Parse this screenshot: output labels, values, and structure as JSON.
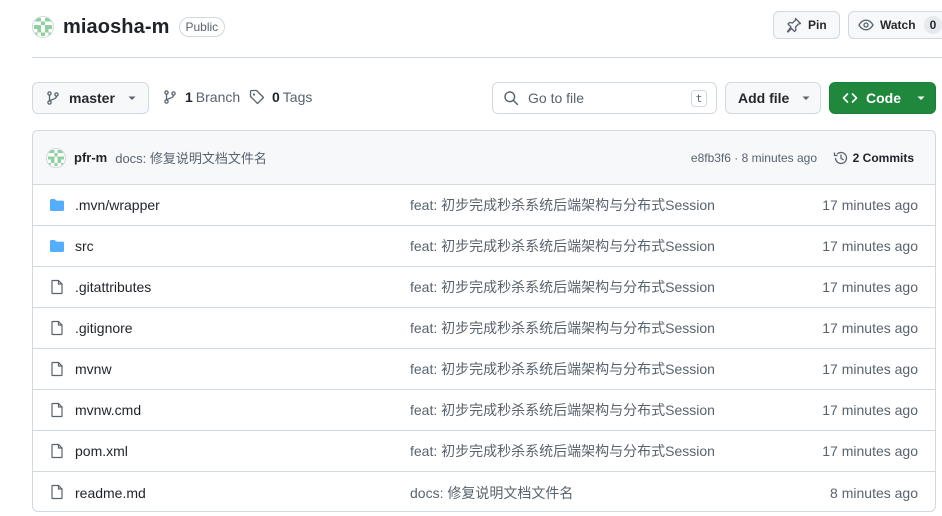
{
  "repo": {
    "name": "miaosha-m",
    "visibility": "Public",
    "pin_label": "Pin",
    "watch_label": "Watch",
    "watch_count": "0"
  },
  "toolbar": {
    "branch": "master",
    "branch_count": "1",
    "branch_label": "Branch",
    "tag_count": "0",
    "tag_label": "Tags",
    "goto_placeholder": "Go to file",
    "goto_shortcut": "t",
    "add_file_label": "Add file",
    "code_label": "Code"
  },
  "colors": {
    "accent_green": "#1f883d",
    "folder_blue": "#54aeff",
    "border": "#d1d9e0"
  },
  "latest_commit": {
    "author": "pfr-m",
    "message": "docs: 修复说明文档文件名",
    "sha_time": "e8fb3f6 · 8 minutes ago",
    "commits_label": "2 Commits"
  },
  "files": [
    {
      "name": ".mvn/wrapper",
      "type": "folder",
      "icon": "folder-icon",
      "message": "feat: 初步完成秒杀系统后端架构与分布式Session",
      "age": "17 minutes ago"
    },
    {
      "name": "src",
      "type": "folder",
      "icon": "folder-icon",
      "message": "feat: 初步完成秒杀系统后端架构与分布式Session",
      "age": "17 minutes ago"
    },
    {
      "name": ".gitattributes",
      "type": "file",
      "icon": "file-icon",
      "message": "feat: 初步完成秒杀系统后端架构与分布式Session",
      "age": "17 minutes ago"
    },
    {
      "name": ".gitignore",
      "type": "file",
      "icon": "file-icon",
      "message": "feat: 初步完成秒杀系统后端架构与分布式Session",
      "age": "17 minutes ago"
    },
    {
      "name": "mvnw",
      "type": "file",
      "icon": "file-icon",
      "message": "feat: 初步完成秒杀系统后端架构与分布式Session",
      "age": "17 minutes ago"
    },
    {
      "name": "mvnw.cmd",
      "type": "file",
      "icon": "file-icon",
      "message": "feat: 初步完成秒杀系统后端架构与分布式Session",
      "age": "17 minutes ago"
    },
    {
      "name": "pom.xml",
      "type": "file",
      "icon": "file-icon",
      "message": "feat: 初步完成秒杀系统后端架构与分布式Session",
      "age": "17 minutes ago"
    },
    {
      "name": "readme.md",
      "type": "file",
      "icon": "file-icon",
      "message": "docs: 修复说明文档文件名",
      "age": "8 minutes ago"
    }
  ]
}
